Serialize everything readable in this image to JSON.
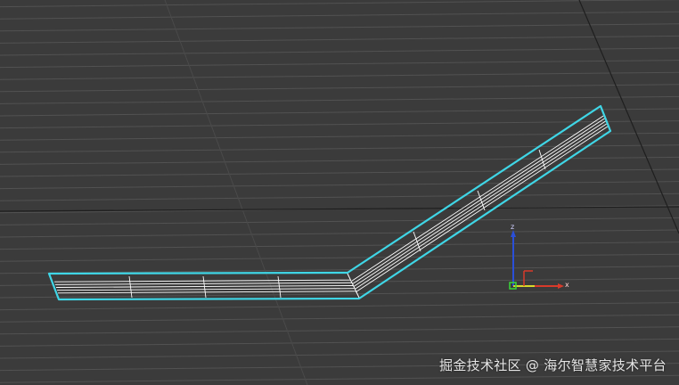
{
  "viewport": {
    "background_color": "#3b3b3b",
    "grid_color": "#525252",
    "grid_major_color": "#1e1e1e",
    "selection_color": "#3fd6e6",
    "wire_color": "#ffffff"
  },
  "gizmo": {
    "z_label": "z",
    "x_label": "x",
    "x_axis_color": "#d83a2a",
    "y_axis_color": "#d8d82a",
    "z_axis_color": "#2a4fd8"
  },
  "watermark": {
    "text": "掘金技术社区 @ 海尔智慧家技术平台"
  }
}
